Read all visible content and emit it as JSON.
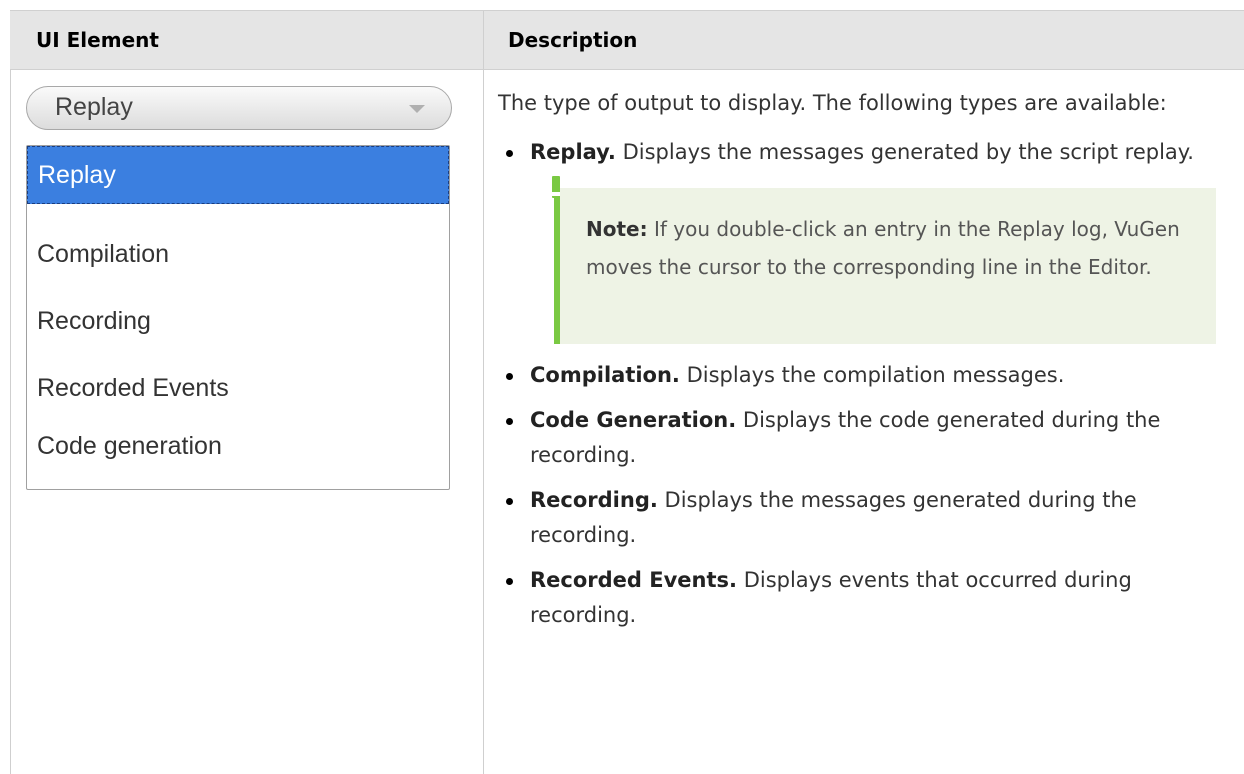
{
  "table": {
    "header": {
      "col1": "UI Element",
      "col2": "Description"
    }
  },
  "dropdown": {
    "selected": "Replay",
    "options": [
      "Replay",
      "Compilation",
      "Recording",
      "Recorded Events",
      "Code generation"
    ]
  },
  "description": {
    "intro": "The type of output to display. The following types are available:",
    "items": [
      {
        "term": "Replay.",
        "text": " Displays the messages generated by the script replay."
      },
      {
        "term": "Compilation.",
        "text": " Displays the compilation messages."
      },
      {
        "term": "Code Generation.",
        "text": " Displays the code generated during the recording."
      },
      {
        "term": "Recording.",
        "text": " Displays the messages generated during the recording."
      },
      {
        "term": "Recorded Events.",
        "text": " Displays events that occurred during recording."
      }
    ],
    "note": {
      "label": "Note:",
      "text": " If you double-click an entry in the Replay log, VuGen moves the cursor to the corresponding line in the Editor."
    }
  },
  "colors": {
    "header_bg": "#e5e5e5",
    "selection": "#3b7fe0",
    "note_bg": "#eef3e5",
    "note_accent": "#7ac943"
  }
}
